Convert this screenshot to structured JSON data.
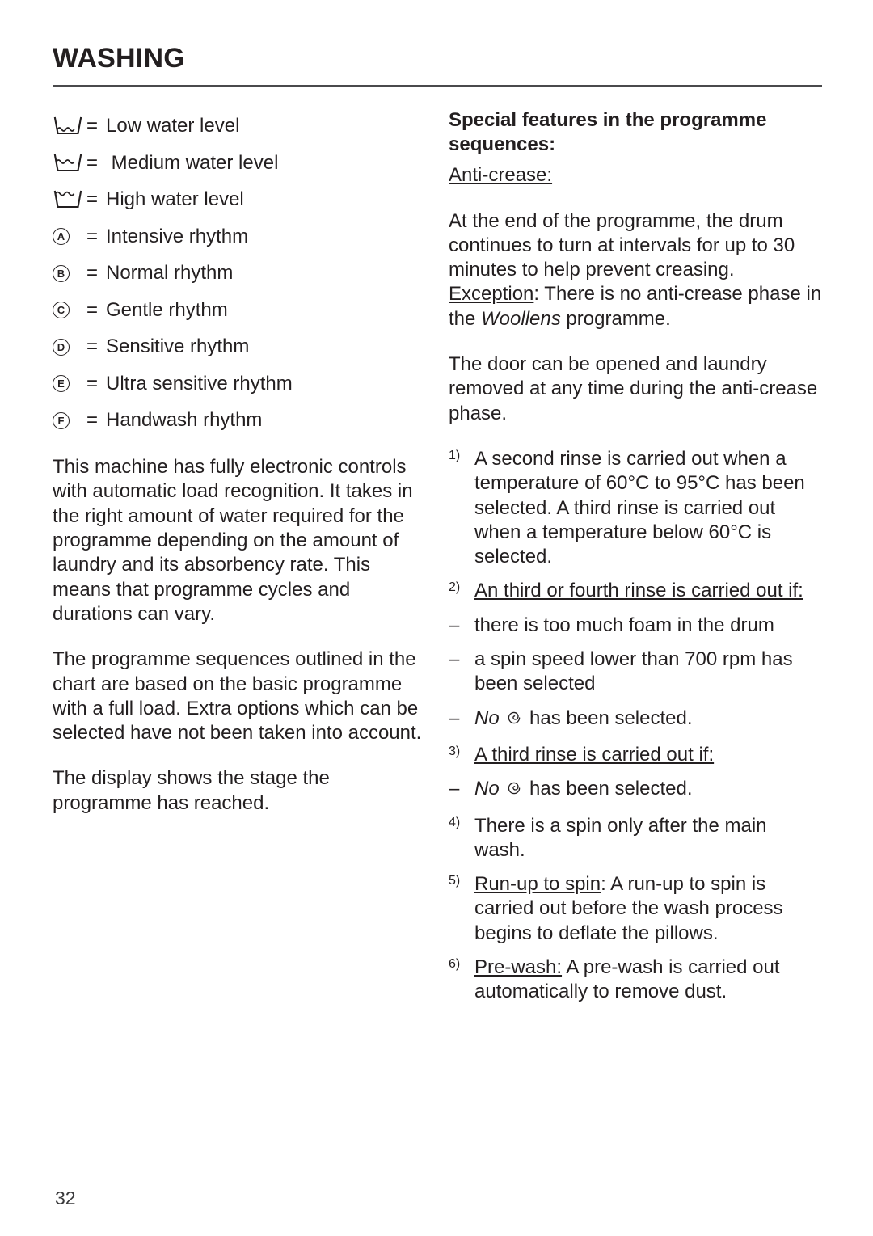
{
  "page": {
    "title": "WASHING",
    "number": "32"
  },
  "left_column": {
    "legend": [
      {
        "icon": "water-level-low-icon",
        "eq": "=",
        "label": "Low water level",
        "level": "low"
      },
      {
        "icon": "water-level-medium-icon",
        "eq": "=",
        "label": " Medium water level",
        "level": "medium"
      },
      {
        "icon": "water-level-high-icon",
        "eq": "=",
        "label": "High water level",
        "level": "high"
      },
      {
        "icon": "circled-letter-a-icon",
        "eq": "=",
        "label": "Intensive rhythm",
        "letter": "A"
      },
      {
        "icon": "circled-letter-b-icon",
        "eq": "=",
        "label": "Normal rhythm",
        "letter": "B"
      },
      {
        "icon": "circled-letter-c-icon",
        "eq": "=",
        "label": "Gentle rhythm",
        "letter": "C"
      },
      {
        "icon": "circled-letter-d-icon",
        "eq": "=",
        "label": "Sensitive rhythm",
        "letter": "D"
      },
      {
        "icon": "circled-letter-e-icon",
        "eq": "=",
        "label": "Ultra sensitive rhythm",
        "letter": "E"
      },
      {
        "icon": "circled-letter-f-icon",
        "eq": "=",
        "label": "Handwash rhythm",
        "letter": "F"
      }
    ],
    "paragraphs": [
      "This machine has fully electronic controls with automatic load recognition. It takes in the right amount of water required for the programme depending on the amount of laundry and its absorbency rate. This means that programme cycles and durations can vary.",
      "The programme sequences outlined in the chart are based on the basic programme with a full load. Extra options which can be selected have not been taken into account.",
      "The display shows the stage the programme has reached."
    ]
  },
  "right_column": {
    "heading": "Special features in the programme sequences:",
    "anti_crease_label": "Anti-crease:",
    "anti_crease_body_1": "At the end of the programme, the drum continues to turn at intervals for up to 30 minutes to help prevent creasing. ",
    "exception_label": "Exception",
    "anti_crease_body_2": ": There is no anti-crease phase in the ",
    "woollens_word": "Woollens",
    "anti_crease_body_3": " programme.",
    "door_paragraph": "The door can be opened and laundry removed at any time during the anti-crease phase.",
    "footnotes": [
      {
        "marker": "1)",
        "text": "A second rinse is carried out when a temperature of 60°C to 95°C has been selected. A third rinse is carried out when a temperature below 60°C is selected."
      },
      {
        "marker": "2)",
        "underlined": "An third or fourth rinse is carried out if:"
      },
      {
        "marker": "3)",
        "underlined": "A third rinse is carried out if:"
      },
      {
        "marker": "4)",
        "text": "There is a spin only after the main wash."
      },
      {
        "marker": "5)",
        "underlined": "Run-up to spin",
        "text": ": A run-up to spin is carried out before the wash process begins to deflate the pillows."
      },
      {
        "marker": "6)",
        "underlined": "Pre-wash:",
        "text": " A pre-wash is carried out automatically to remove dust."
      }
    ],
    "bullets_after_2": [
      {
        "marker": "–",
        "text": "there is too much foam in the drum"
      },
      {
        "marker": "–",
        "text": "a spin speed lower than 700 rpm has been selected"
      }
    ],
    "no_water_plus_before": "No",
    "no_water_plus_after": "has been selected.",
    "dash_marker": "–"
  },
  "colors": {
    "text": "#231f20",
    "rule": "#4a4a4c",
    "page_background": "#ffffff"
  }
}
